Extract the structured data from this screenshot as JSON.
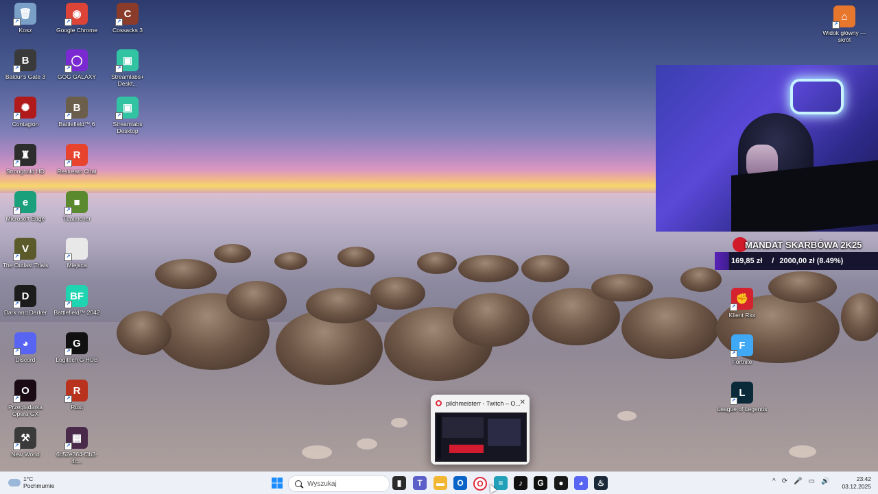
{
  "desktop": {
    "icons": [
      {
        "label": "Kosz",
        "color": "#7aa0c8",
        "glyph": "🗑"
      },
      {
        "label": "Google Chrome",
        "color": "#db4437",
        "glyph": "◉"
      },
      {
        "label": "Cossacks 3",
        "color": "#8a3b2a",
        "glyph": "C"
      },
      {
        "label": "Baldur's Gate 3",
        "color": "#3a3a3a",
        "glyph": "B"
      },
      {
        "label": "GOG GALAXY",
        "color": "#7b2ad1",
        "glyph": "◯"
      },
      {
        "label": "Streamlabs+ Deskt...",
        "color": "#31c3a2",
        "glyph": "▣"
      },
      {
        "label": "Contagion",
        "color": "#b11a1a",
        "glyph": "✺"
      },
      {
        "label": "Battlefield™ 6",
        "color": "#6b5e4a",
        "glyph": "B"
      },
      {
        "label": "Streamlabs Desktop",
        "color": "#31c3a2",
        "glyph": "▣"
      },
      {
        "label": "Stronghold HD",
        "color": "#2d2d2d",
        "glyph": "♜"
      },
      {
        "label": "Restream Chat",
        "color": "#e8432d",
        "glyph": "R"
      },
      {
        "label": "Microsoft Edge",
        "color": "#1aa07a",
        "glyph": "e"
      },
      {
        "label": "TLauncher",
        "color": "#5b8a2e",
        "glyph": "■"
      },
      {
        "label": "The Outlast Trials",
        "color": "#5a5a2a",
        "glyph": "V"
      },
      {
        "label": "Miejsca",
        "color": "#e8e8e8",
        "glyph": ""
      },
      {
        "label": "Dark and Darker",
        "color": "#1c1c1c",
        "glyph": "D"
      },
      {
        "label": "Battlefield™ 2042",
        "color": "#1fd4b1",
        "glyph": "BF"
      },
      {
        "label": "Discord",
        "color": "#5865f2",
        "glyph": "◕"
      },
      {
        "label": "Logitech G HUB",
        "color": "#111111",
        "glyph": "G"
      },
      {
        "label": "Przeglądarka Opera GX",
        "color": "#1a0a14",
        "glyph": "O"
      },
      {
        "label": "Rust",
        "color": "#b8321e",
        "glyph": "R"
      },
      {
        "label": "New World",
        "color": "#3a3a3a",
        "glyph": "⚒"
      },
      {
        "label": "6d52e364-f3b3-4c...",
        "color": "#4a2a4a",
        "glyph": "▦"
      }
    ],
    "right_icons": [
      {
        "label": "Widok główny — skrót",
        "color": "#e8772e",
        "glyph": "⌂"
      },
      {
        "label": "Klient Riot",
        "color": "#d4222e",
        "glyph": "✊"
      },
      {
        "label": "Fortnite",
        "color": "#3fa9f5",
        "glyph": "F"
      },
      {
        "label": "League of Legends",
        "color": "#0a2a3a",
        "glyph": "L"
      }
    ]
  },
  "donation_goal": {
    "title": "MANDAT SKARBÓWA 2K25",
    "current": "169,85 zł",
    "separator": "/",
    "target": "2000,00 zł (8.49%)",
    "progress_fraction": 0.0849
  },
  "preview": {
    "title": "pilchmeisterr - Twitch – O...",
    "close": "✕"
  },
  "taskbar": {
    "weather_temp": "1°C",
    "weather_desc": "Pochmurnie",
    "search_placeholder": "Wyszukaj",
    "time": "23:42",
    "date": "03.12.2025",
    "apps": [
      {
        "name": "task-view",
        "color": "#2b2b2b",
        "glyph": "▮"
      },
      {
        "name": "teams",
        "color": "#5b5fc7",
        "glyph": "T"
      },
      {
        "name": "file-explorer",
        "color": "#f2b632",
        "glyph": "▬"
      },
      {
        "name": "outlook",
        "color": "#0a64c8",
        "glyph": "O"
      },
      {
        "name": "opera-gx",
        "color": "#ffffff",
        "glyph": "O"
      },
      {
        "name": "notepad",
        "color": "#21a0b8",
        "glyph": "≡"
      },
      {
        "name": "tiktok",
        "color": "#111111",
        "glyph": "♪"
      },
      {
        "name": "logitech-g",
        "color": "#111111",
        "glyph": "G"
      },
      {
        "name": "obs-recording",
        "color": "#1a1a1a",
        "glyph": "●"
      },
      {
        "name": "discord",
        "color": "#5865f2",
        "glyph": "◕"
      },
      {
        "name": "steam",
        "color": "#1b2838",
        "glyph": "♨"
      }
    ],
    "tray": [
      "^",
      "⟳",
      "🎤",
      "▭",
      "🔊"
    ]
  }
}
